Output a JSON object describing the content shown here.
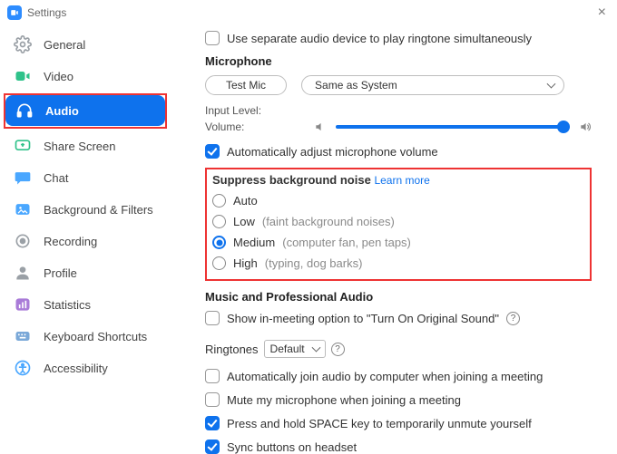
{
  "titlebar": {
    "title": "Settings"
  },
  "sidebar": {
    "items": [
      {
        "label": "General"
      },
      {
        "label": "Video"
      },
      {
        "label": "Audio"
      },
      {
        "label": "Share Screen"
      },
      {
        "label": "Chat"
      },
      {
        "label": "Background & Filters"
      },
      {
        "label": "Recording"
      },
      {
        "label": "Profile"
      },
      {
        "label": "Statistics"
      },
      {
        "label": "Keyboard Shortcuts"
      },
      {
        "label": "Accessibility"
      }
    ]
  },
  "audio": {
    "separate_device": "Use separate audio device to play ringtone simultaneously",
    "mic_title": "Microphone",
    "test_mic": "Test Mic",
    "mic_device": "Same as System",
    "input_level": "Input Level:",
    "volume": "Volume:",
    "auto_adjust": "Automatically adjust microphone volume",
    "noise": {
      "title": "Suppress background noise",
      "learn": "Learn more",
      "auto": "Auto",
      "low": "Low",
      "low_hint": "(faint background noises)",
      "medium": "Medium",
      "medium_hint": "(computer fan, pen taps)",
      "high": "High",
      "high_hint": "(typing, dog barks)"
    },
    "pro_title": "Music and Professional Audio",
    "pro_opt": "Show in-meeting option to \"Turn On Original Sound\"",
    "ringtones_label": "Ringtones",
    "ringtones_value": "Default",
    "auto_join": "Automatically join audio by computer when joining a meeting",
    "mute_join": "Mute my microphone when joining a meeting",
    "space_unmute": "Press and hold SPACE key to temporarily unmute yourself",
    "sync_headset": "Sync buttons on headset"
  }
}
